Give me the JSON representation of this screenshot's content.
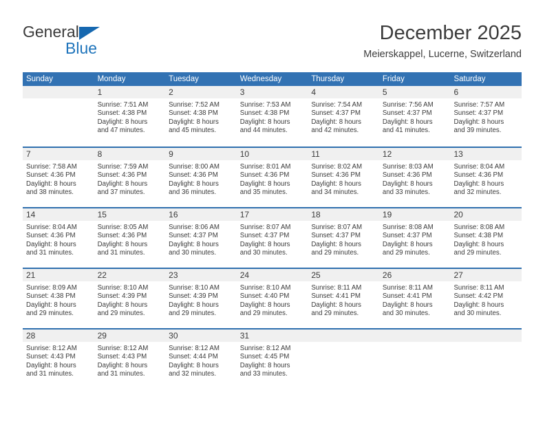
{
  "brand": {
    "name_part1": "General",
    "name_part2": "Blue",
    "triangle_color": "#1668b0",
    "text_color": "#3a3a3a",
    "blue_color": "#1e74bb"
  },
  "header": {
    "title": "December 2025",
    "subtitle": "Meierskappel, Lucerne, Switzerland"
  },
  "theme": {
    "header_blue": "#3272b3",
    "row_divider_blue": "#2f6fae",
    "day_strip_gray": "#f0f0f0",
    "text_color": "#3a3a3a"
  },
  "weekdays": [
    "Sunday",
    "Monday",
    "Tuesday",
    "Wednesday",
    "Thursday",
    "Friday",
    "Saturday"
  ],
  "weeks": [
    [
      {
        "day": "",
        "empty": true,
        "sunrise": "",
        "sunset": "",
        "daylight_line1": "",
        "daylight_line2": ""
      },
      {
        "day": "1",
        "empty": false,
        "sunrise": "Sunrise: 7:51 AM",
        "sunset": "Sunset: 4:38 PM",
        "daylight_line1": "Daylight: 8 hours",
        "daylight_line2": "and 47 minutes."
      },
      {
        "day": "2",
        "empty": false,
        "sunrise": "Sunrise: 7:52 AM",
        "sunset": "Sunset: 4:38 PM",
        "daylight_line1": "Daylight: 8 hours",
        "daylight_line2": "and 45 minutes."
      },
      {
        "day": "3",
        "empty": false,
        "sunrise": "Sunrise: 7:53 AM",
        "sunset": "Sunset: 4:38 PM",
        "daylight_line1": "Daylight: 8 hours",
        "daylight_line2": "and 44 minutes."
      },
      {
        "day": "4",
        "empty": false,
        "sunrise": "Sunrise: 7:54 AM",
        "sunset": "Sunset: 4:37 PM",
        "daylight_line1": "Daylight: 8 hours",
        "daylight_line2": "and 42 minutes."
      },
      {
        "day": "5",
        "empty": false,
        "sunrise": "Sunrise: 7:56 AM",
        "sunset": "Sunset: 4:37 PM",
        "daylight_line1": "Daylight: 8 hours",
        "daylight_line2": "and 41 minutes."
      },
      {
        "day": "6",
        "empty": false,
        "sunrise": "Sunrise: 7:57 AM",
        "sunset": "Sunset: 4:37 PM",
        "daylight_line1": "Daylight: 8 hours",
        "daylight_line2": "and 39 minutes."
      }
    ],
    [
      {
        "day": "7",
        "empty": false,
        "sunrise": "Sunrise: 7:58 AM",
        "sunset": "Sunset: 4:36 PM",
        "daylight_line1": "Daylight: 8 hours",
        "daylight_line2": "and 38 minutes."
      },
      {
        "day": "8",
        "empty": false,
        "sunrise": "Sunrise: 7:59 AM",
        "sunset": "Sunset: 4:36 PM",
        "daylight_line1": "Daylight: 8 hours",
        "daylight_line2": "and 37 minutes."
      },
      {
        "day": "9",
        "empty": false,
        "sunrise": "Sunrise: 8:00 AM",
        "sunset": "Sunset: 4:36 PM",
        "daylight_line1": "Daylight: 8 hours",
        "daylight_line2": "and 36 minutes."
      },
      {
        "day": "10",
        "empty": false,
        "sunrise": "Sunrise: 8:01 AM",
        "sunset": "Sunset: 4:36 PM",
        "daylight_line1": "Daylight: 8 hours",
        "daylight_line2": "and 35 minutes."
      },
      {
        "day": "11",
        "empty": false,
        "sunrise": "Sunrise: 8:02 AM",
        "sunset": "Sunset: 4:36 PM",
        "daylight_line1": "Daylight: 8 hours",
        "daylight_line2": "and 34 minutes."
      },
      {
        "day": "12",
        "empty": false,
        "sunrise": "Sunrise: 8:03 AM",
        "sunset": "Sunset: 4:36 PM",
        "daylight_line1": "Daylight: 8 hours",
        "daylight_line2": "and 33 minutes."
      },
      {
        "day": "13",
        "empty": false,
        "sunrise": "Sunrise: 8:04 AM",
        "sunset": "Sunset: 4:36 PM",
        "daylight_line1": "Daylight: 8 hours",
        "daylight_line2": "and 32 minutes."
      }
    ],
    [
      {
        "day": "14",
        "empty": false,
        "sunrise": "Sunrise: 8:04 AM",
        "sunset": "Sunset: 4:36 PM",
        "daylight_line1": "Daylight: 8 hours",
        "daylight_line2": "and 31 minutes."
      },
      {
        "day": "15",
        "empty": false,
        "sunrise": "Sunrise: 8:05 AM",
        "sunset": "Sunset: 4:36 PM",
        "daylight_line1": "Daylight: 8 hours",
        "daylight_line2": "and 31 minutes."
      },
      {
        "day": "16",
        "empty": false,
        "sunrise": "Sunrise: 8:06 AM",
        "sunset": "Sunset: 4:37 PM",
        "daylight_line1": "Daylight: 8 hours",
        "daylight_line2": "and 30 minutes."
      },
      {
        "day": "17",
        "empty": false,
        "sunrise": "Sunrise: 8:07 AM",
        "sunset": "Sunset: 4:37 PM",
        "daylight_line1": "Daylight: 8 hours",
        "daylight_line2": "and 30 minutes."
      },
      {
        "day": "18",
        "empty": false,
        "sunrise": "Sunrise: 8:07 AM",
        "sunset": "Sunset: 4:37 PM",
        "daylight_line1": "Daylight: 8 hours",
        "daylight_line2": "and 29 minutes."
      },
      {
        "day": "19",
        "empty": false,
        "sunrise": "Sunrise: 8:08 AM",
        "sunset": "Sunset: 4:37 PM",
        "daylight_line1": "Daylight: 8 hours",
        "daylight_line2": "and 29 minutes."
      },
      {
        "day": "20",
        "empty": false,
        "sunrise": "Sunrise: 8:08 AM",
        "sunset": "Sunset: 4:38 PM",
        "daylight_line1": "Daylight: 8 hours",
        "daylight_line2": "and 29 minutes."
      }
    ],
    [
      {
        "day": "21",
        "empty": false,
        "sunrise": "Sunrise: 8:09 AM",
        "sunset": "Sunset: 4:38 PM",
        "daylight_line1": "Daylight: 8 hours",
        "daylight_line2": "and 29 minutes."
      },
      {
        "day": "22",
        "empty": false,
        "sunrise": "Sunrise: 8:10 AM",
        "sunset": "Sunset: 4:39 PM",
        "daylight_line1": "Daylight: 8 hours",
        "daylight_line2": "and 29 minutes."
      },
      {
        "day": "23",
        "empty": false,
        "sunrise": "Sunrise: 8:10 AM",
        "sunset": "Sunset: 4:39 PM",
        "daylight_line1": "Daylight: 8 hours",
        "daylight_line2": "and 29 minutes."
      },
      {
        "day": "24",
        "empty": false,
        "sunrise": "Sunrise: 8:10 AM",
        "sunset": "Sunset: 4:40 PM",
        "daylight_line1": "Daylight: 8 hours",
        "daylight_line2": "and 29 minutes."
      },
      {
        "day": "25",
        "empty": false,
        "sunrise": "Sunrise: 8:11 AM",
        "sunset": "Sunset: 4:41 PM",
        "daylight_line1": "Daylight: 8 hours",
        "daylight_line2": "and 29 minutes."
      },
      {
        "day": "26",
        "empty": false,
        "sunrise": "Sunrise: 8:11 AM",
        "sunset": "Sunset: 4:41 PM",
        "daylight_line1": "Daylight: 8 hours",
        "daylight_line2": "and 30 minutes."
      },
      {
        "day": "27",
        "empty": false,
        "sunrise": "Sunrise: 8:11 AM",
        "sunset": "Sunset: 4:42 PM",
        "daylight_line1": "Daylight: 8 hours",
        "daylight_line2": "and 30 minutes."
      }
    ],
    [
      {
        "day": "28",
        "empty": false,
        "sunrise": "Sunrise: 8:12 AM",
        "sunset": "Sunset: 4:43 PM",
        "daylight_line1": "Daylight: 8 hours",
        "daylight_line2": "and 31 minutes."
      },
      {
        "day": "29",
        "empty": false,
        "sunrise": "Sunrise: 8:12 AM",
        "sunset": "Sunset: 4:43 PM",
        "daylight_line1": "Daylight: 8 hours",
        "daylight_line2": "and 31 minutes."
      },
      {
        "day": "30",
        "empty": false,
        "sunrise": "Sunrise: 8:12 AM",
        "sunset": "Sunset: 4:44 PM",
        "daylight_line1": "Daylight: 8 hours",
        "daylight_line2": "and 32 minutes."
      },
      {
        "day": "31",
        "empty": false,
        "sunrise": "Sunrise: 8:12 AM",
        "sunset": "Sunset: 4:45 PM",
        "daylight_line1": "Daylight: 8 hours",
        "daylight_line2": "and 33 minutes."
      },
      {
        "day": "",
        "empty": true,
        "sunrise": "",
        "sunset": "",
        "daylight_line1": "",
        "daylight_line2": ""
      },
      {
        "day": "",
        "empty": true,
        "sunrise": "",
        "sunset": "",
        "daylight_line1": "",
        "daylight_line2": ""
      },
      {
        "day": "",
        "empty": true,
        "sunrise": "",
        "sunset": "",
        "daylight_line1": "",
        "daylight_line2": ""
      }
    ]
  ]
}
